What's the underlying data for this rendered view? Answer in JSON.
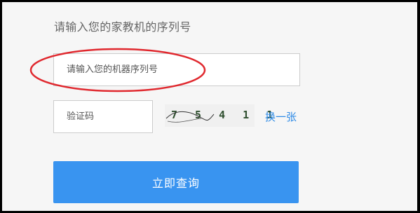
{
  "form": {
    "heading": "请输入您的家教机的序列号",
    "serial_placeholder": "请输入您的机器序列号",
    "serial_value": "",
    "captcha_placeholder": "验证码",
    "captcha_value": "",
    "captcha_code": "7 5 4 1 1",
    "refresh_label": "换一张",
    "submit_label": "立即查询"
  },
  "colors": {
    "background": "#f6f6f6",
    "accent": "#3994f0",
    "link": "#2f8be6",
    "annotation": "#e0282e"
  }
}
